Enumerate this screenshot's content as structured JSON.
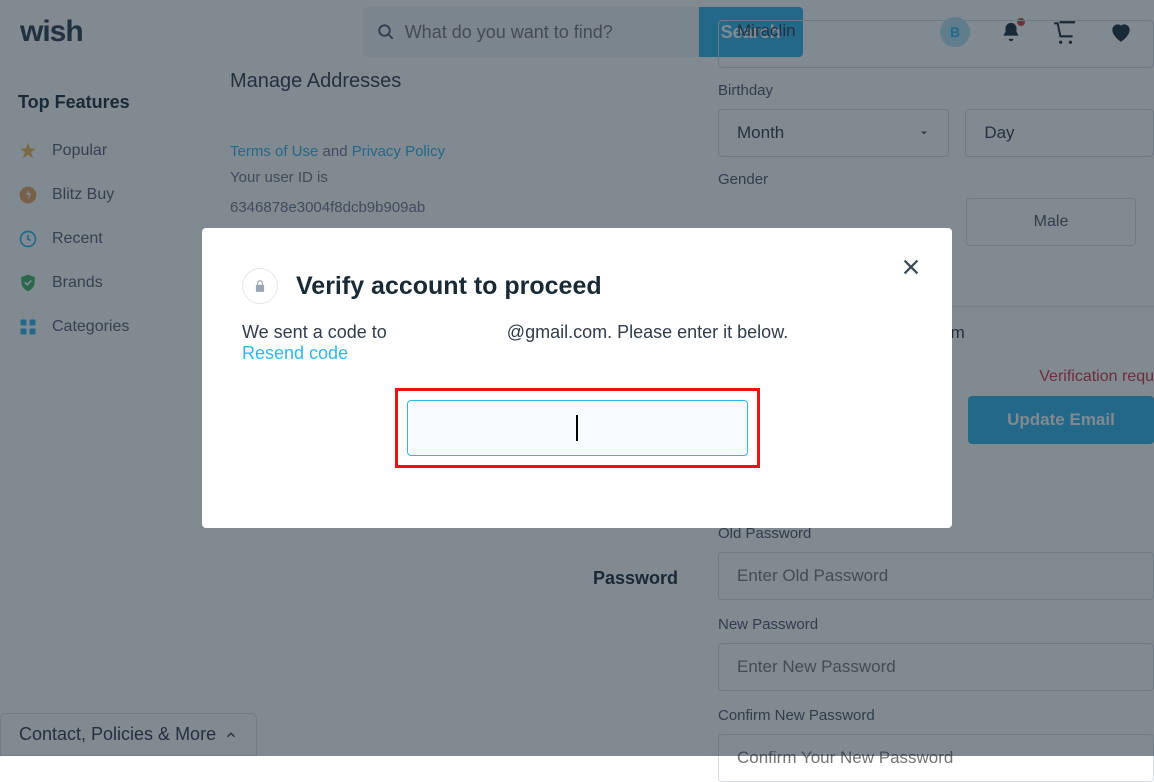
{
  "header": {
    "logo": "wish",
    "search_placeholder": "What do you want to find?",
    "search_button": "Search",
    "avatar_initial": "B"
  },
  "sidebar": {
    "heading": "Top Features",
    "items": [
      {
        "label": "Popular"
      },
      {
        "label": "Blitz Buy"
      },
      {
        "label": "Recent"
      },
      {
        "label": "Brands"
      },
      {
        "label": "Categories"
      }
    ]
  },
  "manage": {
    "title": "Manage Addresses",
    "tos": "Terms of Use",
    "and": " and ",
    "pp": "Privacy Policy",
    "userid_label": "Your user ID is",
    "userid": "6346878e3004f8dcb9b909ab"
  },
  "form": {
    "last_name_value": "Miraclin",
    "birthday_label": "Birthday",
    "month": "Month",
    "day": "Day",
    "gender_label": "Gender",
    "male": "Male",
    "email_suffix": ".com",
    "verification": "Verification requ",
    "update_email": "Update Email",
    "password_heading": "Password",
    "old_pw_label": "Old Password",
    "old_pw_ph": "Enter Old Password",
    "new_pw_label": "New Password",
    "new_pw_ph": "Enter New Password",
    "conf_pw_label": "Confirm New Password",
    "conf_pw_ph": "Confirm Your New Password"
  },
  "footer": {
    "contact": "Contact, Policies & More"
  },
  "modal": {
    "title": "Verify account to proceed",
    "text_pre": "We sent a code to ",
    "text_mid": "@gmail.com. Please enter it below.",
    "resend": "Resend code"
  }
}
